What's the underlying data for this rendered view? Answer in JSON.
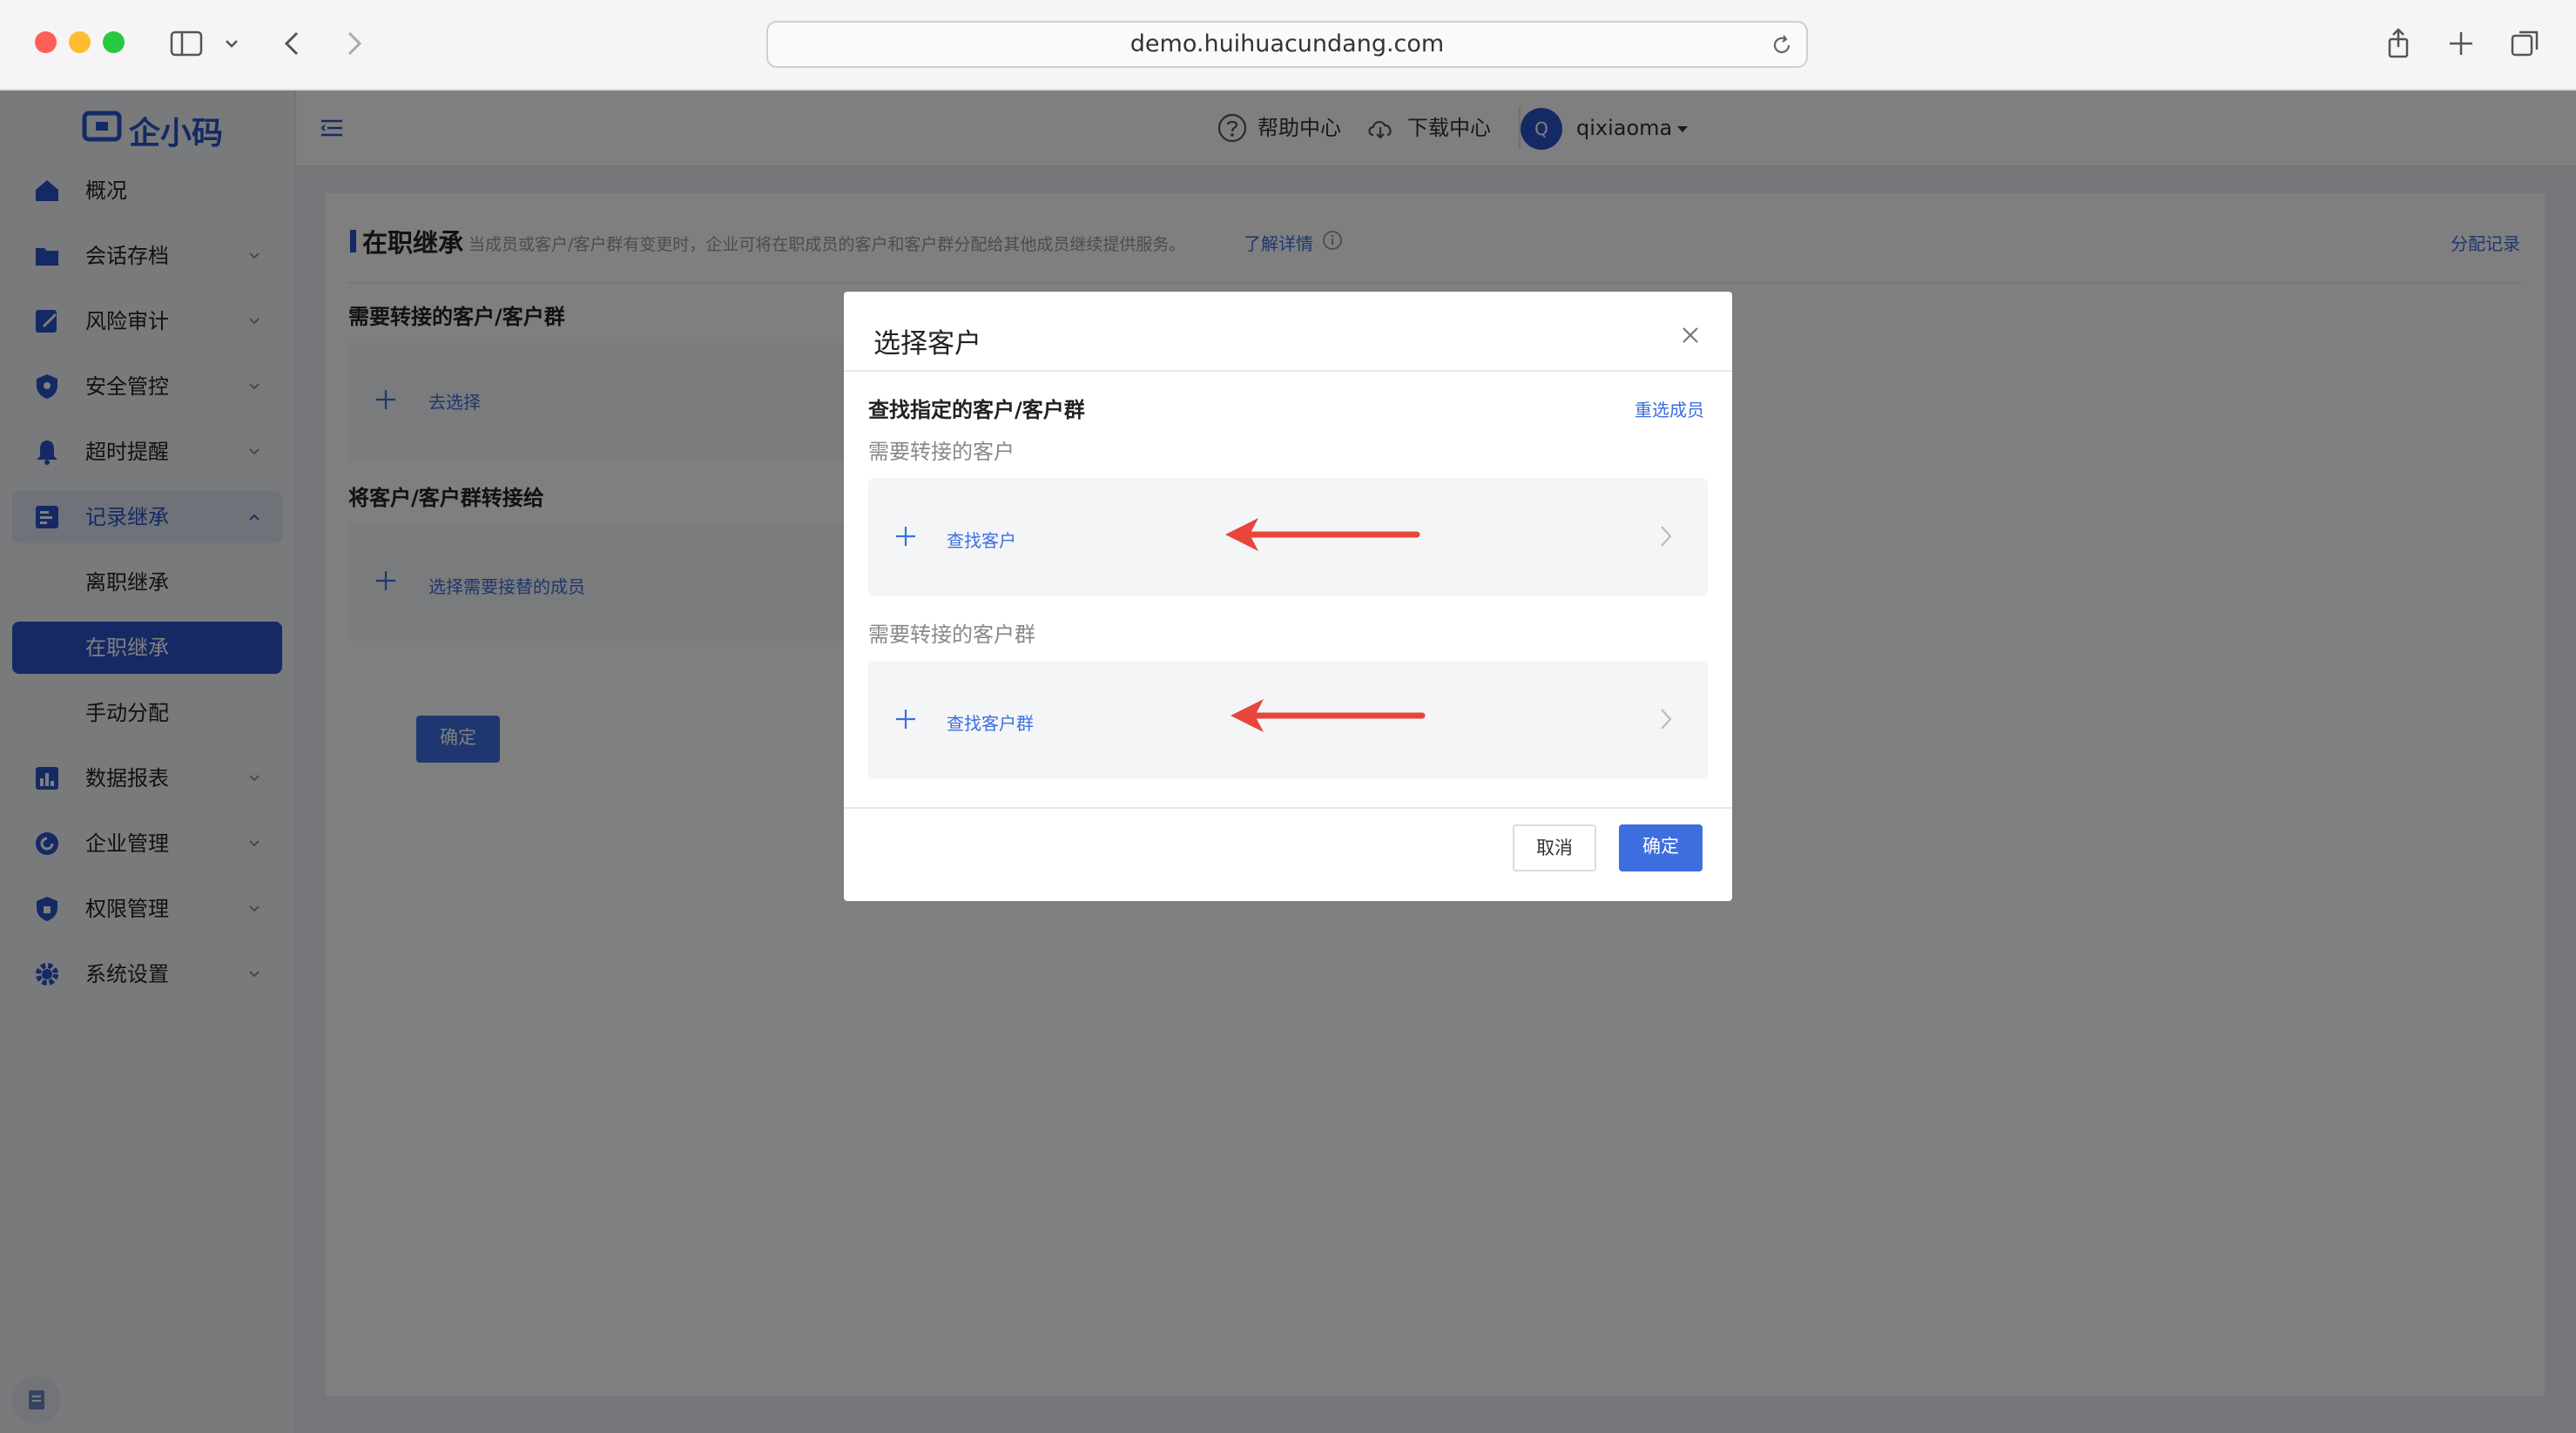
{
  "browser": {
    "url": "demo.huihuacundang.com"
  },
  "app": {
    "logo_text": "企小码",
    "header": {
      "help": "帮助中心",
      "download": "下载中心",
      "user_initial": "Q",
      "user_name": "qixiaoma"
    },
    "sidebar": {
      "items": [
        {
          "label": "概况",
          "icon": "home-icon",
          "expandable": false
        },
        {
          "label": "会话存档",
          "icon": "folder-icon",
          "expandable": true
        },
        {
          "label": "风险审计",
          "icon": "edit-icon",
          "expandable": true
        },
        {
          "label": "安全管控",
          "icon": "shield-icon",
          "expandable": true
        },
        {
          "label": "超时提醒",
          "icon": "bell-icon",
          "expandable": true
        },
        {
          "label": "记录继承",
          "icon": "record-icon",
          "expandable": true,
          "expanded": true
        },
        {
          "label": "数据报表",
          "icon": "chart-icon",
          "expandable": true
        },
        {
          "label": "企业管理",
          "icon": "refresh-icon",
          "expandable": true
        },
        {
          "label": "权限管理",
          "icon": "lock-shield-icon",
          "expandable": true
        },
        {
          "label": "系统设置",
          "icon": "gear-icon",
          "expandable": true
        }
      ],
      "sub_items": [
        {
          "label": "离职继承",
          "active": false
        },
        {
          "label": "在职继承",
          "active": true
        },
        {
          "label": "手动分配",
          "active": false
        }
      ]
    },
    "page": {
      "title": "在职继承",
      "description": "当成员或客户/客户群有变更时，企业可将在职成员的客户和客户群分配给其他成员继续提供服务。",
      "learn_more": "了解详情",
      "allocation_record": "分配记录",
      "section1_title": "需要转接的客户/客户群",
      "section1_action": "去选择",
      "section2_title": "将客户/客户群转接给",
      "section2_action": "选择需要接替的成员",
      "confirm": "确定"
    }
  },
  "modal": {
    "title": "选择客户",
    "subtitle": "查找指定的客户/客户群",
    "reselect": "重选成员",
    "customers_label": "需要转接的客户",
    "find_customer": "查找客户",
    "groups_label": "需要转接的客户群",
    "find_group": "查找客户群",
    "cancel": "取消",
    "confirm": "确定"
  },
  "colors": {
    "primary": "#3c6ee0",
    "active_menu": "#2b55c8",
    "arrow": "#e8463c"
  }
}
